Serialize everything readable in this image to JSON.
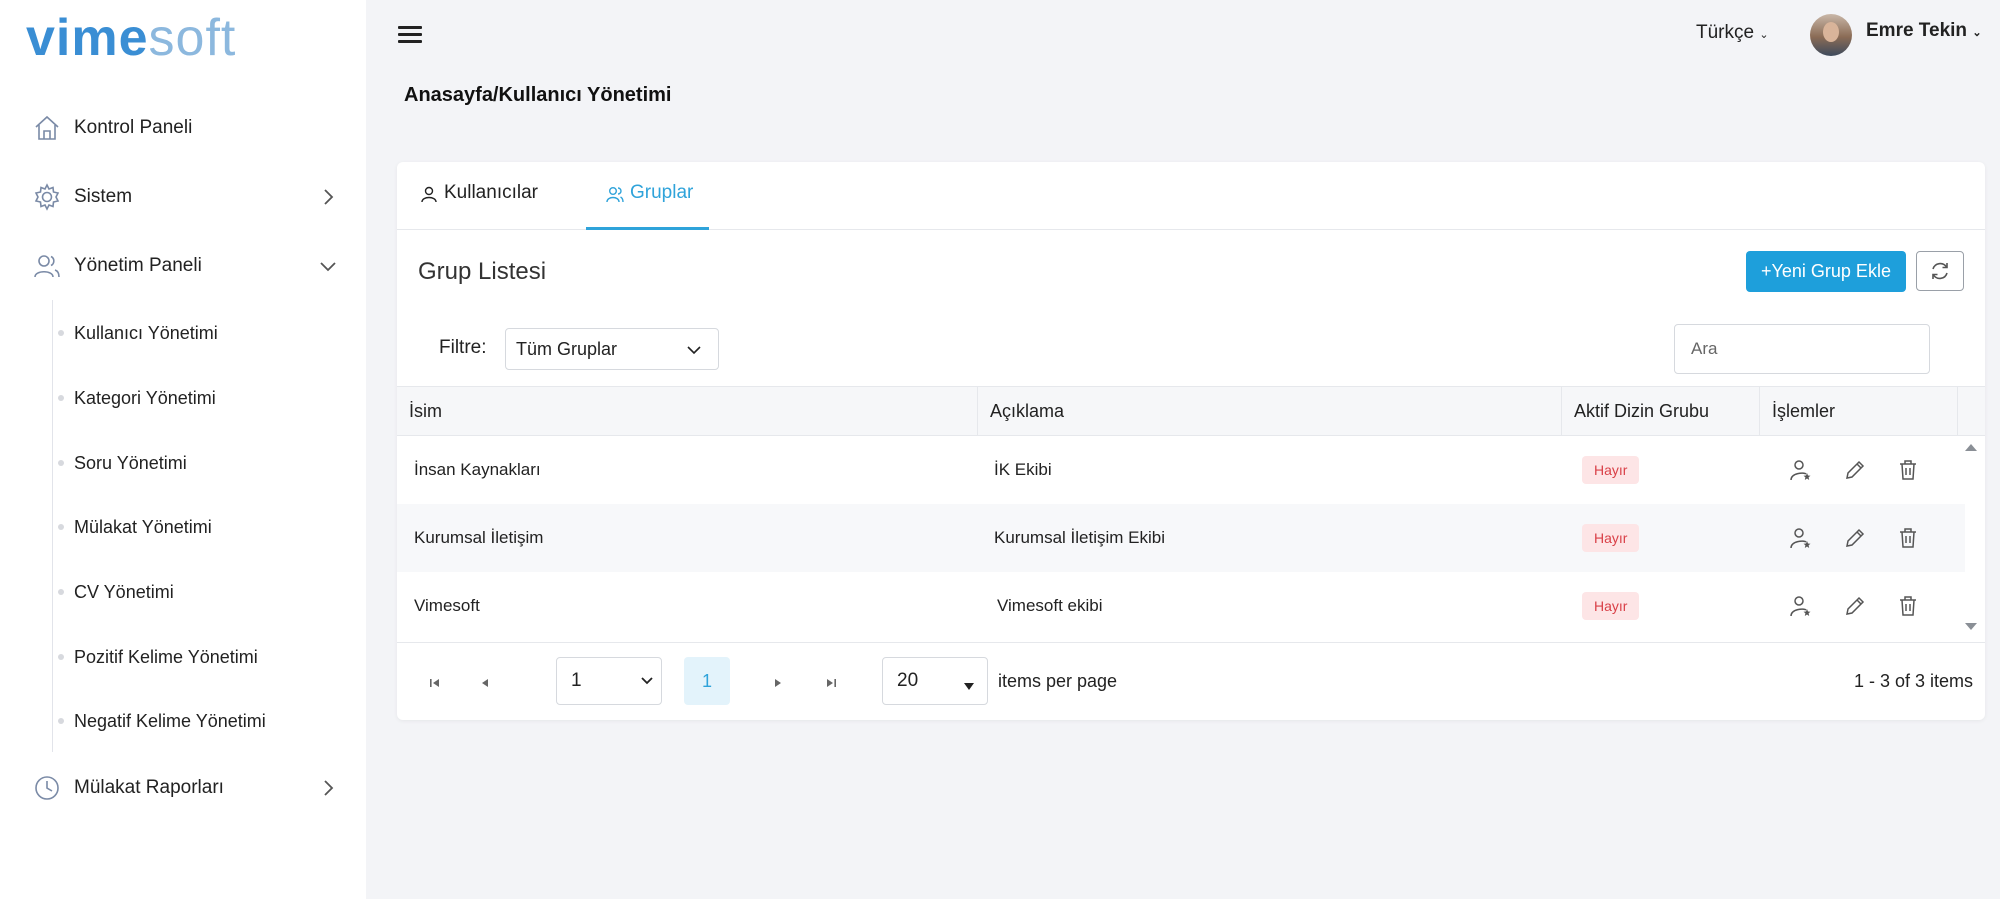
{
  "brand": {
    "logo_bold": "vime",
    "logo_light": "soft"
  },
  "header": {
    "language": "Türkçe",
    "user_name": "Emre Tekin"
  },
  "breadcrumb": "Anasayfa/Kullanıcı Yönetimi",
  "sidebar": {
    "items": [
      {
        "label": "Kontrol Paneli",
        "icon": "home-icon"
      },
      {
        "label": "Sistem",
        "icon": "gear-icon"
      },
      {
        "label": "Yönetim Paneli",
        "icon": "users-icon"
      },
      {
        "label": "Mülakat Raporları",
        "icon": "clock-icon"
      }
    ],
    "subitems": [
      "Kullanıcı Yönetimi",
      "Kategori Yönetimi",
      "Soru Yönetimi",
      "Mülakat Yönetimi",
      "CV Yönetimi",
      "Pozitif Kelime Yönetimi",
      "Negatif Kelime Yönetimi"
    ]
  },
  "tabs": [
    {
      "label": "Kullanıcılar",
      "active": false
    },
    {
      "label": "Gruplar",
      "active": true
    }
  ],
  "card": {
    "title": "Grup Listesi",
    "add_button": "+Yeni Grup Ekle",
    "filter_label": "Filtre:",
    "filter_value": "Tüm Gruplar",
    "search_placeholder": "Ara"
  },
  "table": {
    "columns": [
      "İsim",
      "Açıklama",
      "Aktif Dizin Grubu",
      "İşlemler"
    ],
    "rows": [
      {
        "name": "İnsan Kaynakları",
        "description": "İK Ekibi",
        "active_directory": "Hayır"
      },
      {
        "name": "Kurumsal İletişim",
        "description": "Kurumsal İletişim Ekibi",
        "active_directory": "Hayır"
      },
      {
        "name": "Vimesoft",
        "description": "Vimesoft ekibi",
        "active_directory": "Hayır"
      }
    ]
  },
  "pager": {
    "page_select": "1",
    "current_page": "1",
    "page_size": "20",
    "per_page_label": "items per page",
    "summary": "1 - 3 of 3 items"
  },
  "colors": {
    "accent": "#1e9fdb",
    "badge_bg": "#fde5e6",
    "badge_text": "#d94047",
    "logo": "#3a8ed4"
  }
}
